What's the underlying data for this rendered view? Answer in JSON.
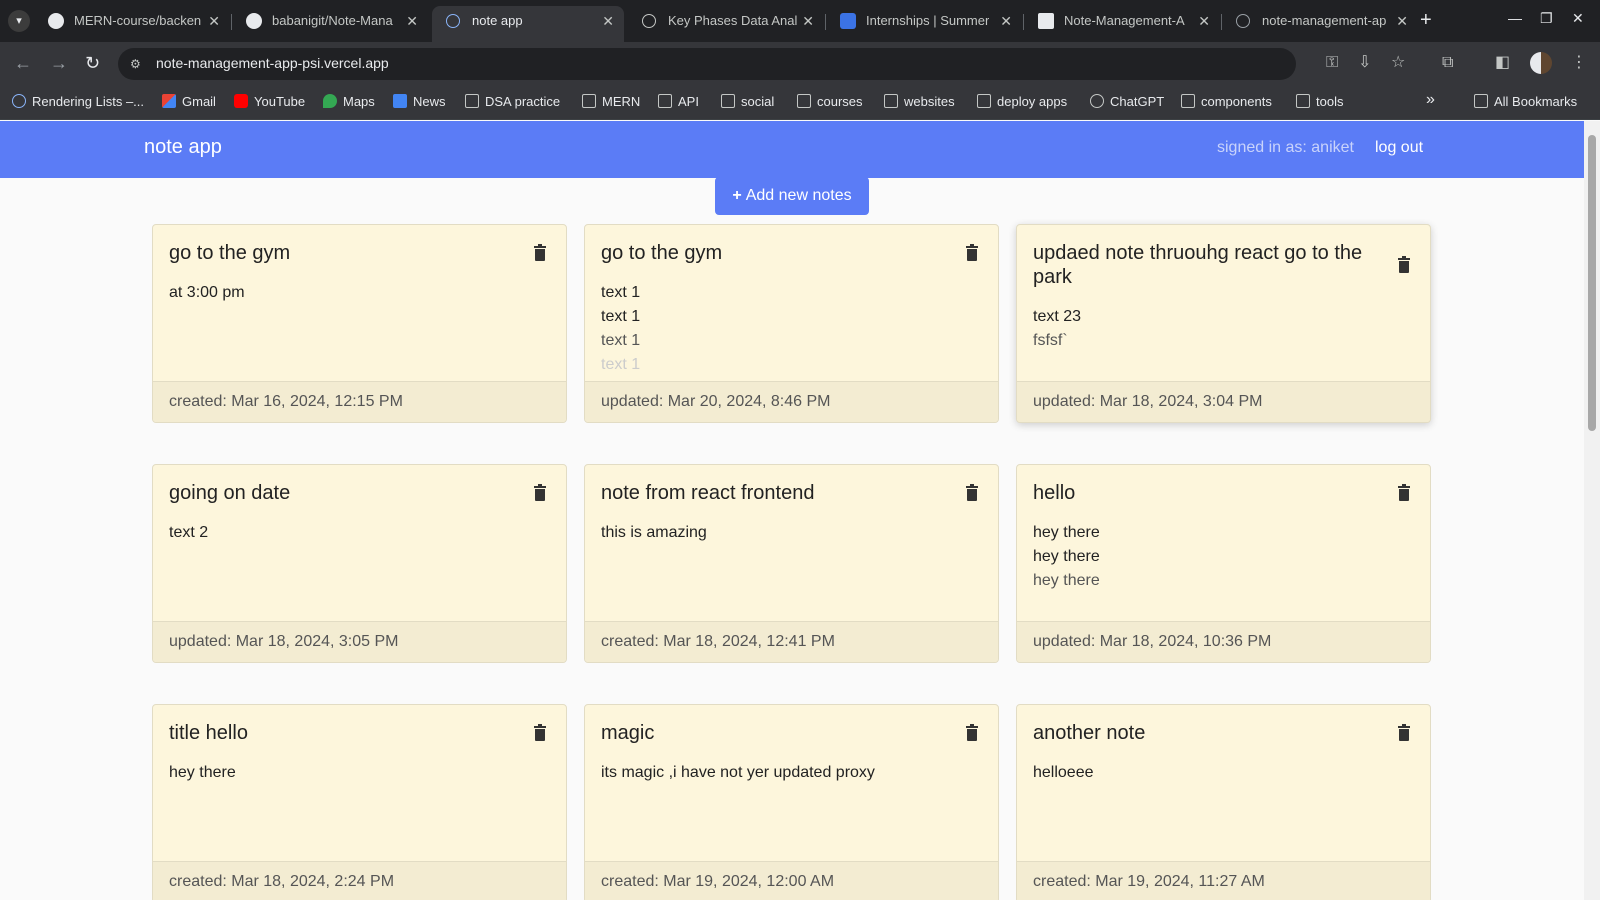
{
  "browser": {
    "tabs": [
      {
        "title": "MERN-course/backen",
        "favicon": "github-icon"
      },
      {
        "title": "babanigit/Note-Mana",
        "favicon": "github-icon"
      },
      {
        "title": "note app",
        "favicon": "react-icon",
        "active": true
      },
      {
        "title": "Key Phases Data Anal",
        "favicon": "chatgpt-icon"
      },
      {
        "title": "Internships | Summer",
        "favicon": "is-icon"
      },
      {
        "title": "Note-Management-A",
        "favicon": "vercel-icon"
      },
      {
        "title": "note-management-ap",
        "favicon": "globe-icon"
      }
    ],
    "url": "note-management-app-psi.vercel.app",
    "bookmarks": [
      {
        "label": "Rendering Lists –...",
        "icon": "react-icon"
      },
      {
        "label": "Gmail",
        "icon": "gmail-icon"
      },
      {
        "label": "YouTube",
        "icon": "youtube-icon"
      },
      {
        "label": "Maps",
        "icon": "maps-icon"
      },
      {
        "label": "News",
        "icon": "news-icon"
      },
      {
        "label": "DSA practice",
        "icon": "folder-icon"
      },
      {
        "label": "MERN",
        "icon": "folder-icon"
      },
      {
        "label": "API",
        "icon": "folder-icon"
      },
      {
        "label": "social",
        "icon": "folder-icon"
      },
      {
        "label": "courses",
        "icon": "folder-icon"
      },
      {
        "label": "websites",
        "icon": "folder-icon"
      },
      {
        "label": "deploy apps",
        "icon": "folder-icon"
      },
      {
        "label": "ChatGPT",
        "icon": "chatgpt-icon"
      },
      {
        "label": "components",
        "icon": "folder-icon"
      },
      {
        "label": "tools",
        "icon": "folder-icon"
      }
    ],
    "all_bookmarks": "All Bookmarks"
  },
  "app": {
    "brand": "note app",
    "signed_in": "signed in as: aniket",
    "logout": "log out",
    "add_button": "Add new notes",
    "accent_color": "#5b7cf6",
    "card_color": "#fdf6dc"
  },
  "notes": [
    {
      "title": "go to the gym",
      "lines": [
        "at 3:00 pm"
      ],
      "footer": "created: Mar 16, 2024, 12:15 PM"
    },
    {
      "title": "go to the gym",
      "lines": [
        "text 1",
        "text 1",
        "text 1",
        "text 1"
      ],
      "footer": "updated: Mar 20, 2024, 8:46 PM"
    },
    {
      "title": "updaed note thruouhg react go to the park",
      "lines": [
        "text 23",
        "fsfsf`"
      ],
      "footer": "updated: Mar 18, 2024, 3:04 PM"
    },
    {
      "title": "going on date",
      "lines": [
        "text 2"
      ],
      "footer": "updated: Mar 18, 2024, 3:05 PM"
    },
    {
      "title": "note from react frontend",
      "lines": [
        "this is amazing"
      ],
      "footer": "created: Mar 18, 2024, 12:41 PM"
    },
    {
      "title": "hello",
      "lines": [
        "hey there",
        "hey there",
        "hey there"
      ],
      "footer": "updated: Mar 18, 2024, 10:36 PM"
    },
    {
      "title": "title hello",
      "lines": [
        "hey there"
      ],
      "footer": "created: Mar 18, 2024, 2:24 PM"
    },
    {
      "title": "magic",
      "lines": [
        "its magic ,i have not yer updated proxy"
      ],
      "footer": "created: Mar 19, 2024, 12:00 AM"
    },
    {
      "title": "another note",
      "lines": [
        "helloeee"
      ],
      "footer": "created: Mar 19, 2024, 11:27 AM"
    }
  ]
}
